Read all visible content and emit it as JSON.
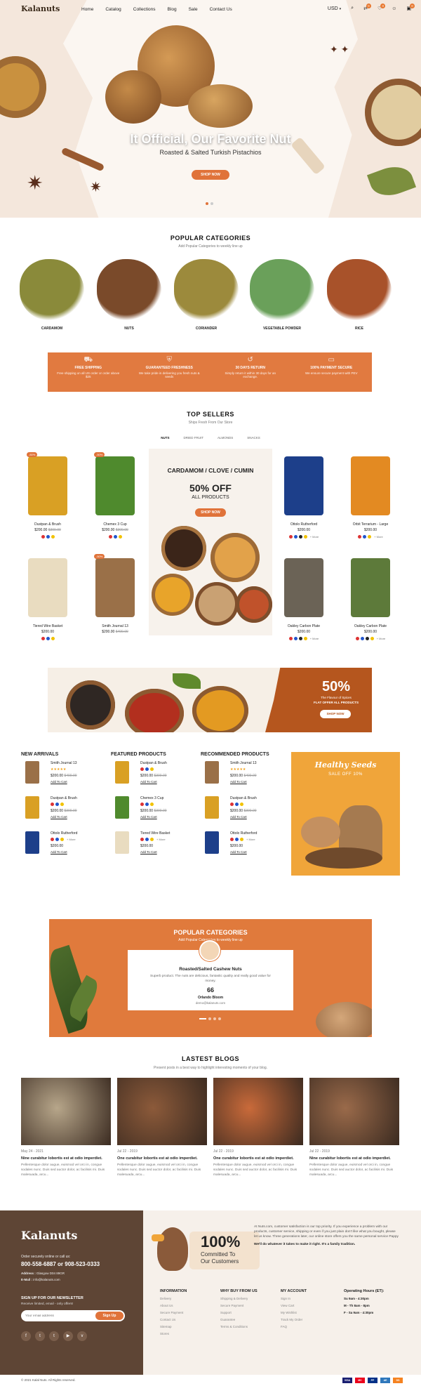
{
  "header": {
    "logo": "Kalanuts",
    "nav": [
      "Home",
      "Catalog",
      "Collections",
      "Blog",
      "Sale",
      "Contact Us"
    ],
    "currency": "USD",
    "compare_count": "0",
    "wishlist_count": "0",
    "cart_count": "0"
  },
  "hero": {
    "title": "It Official, Our Favorite Nut",
    "subtitle": "Roasted & Salted Turkish Pistachios",
    "button": "SHOP NOW"
  },
  "categories": {
    "title": "POPULAR CATEGORIES",
    "subtitle": "Add Popular Categories to weekly line up",
    "items": [
      {
        "label": "CARDAMOM",
        "color": "#8a8a3a"
      },
      {
        "label": "NUTS",
        "color": "#7a4a2a"
      },
      {
        "label": "CORIANDER",
        "color": "#9c8a3c"
      },
      {
        "label": "VEGETABLE POWDER",
        "color": "#6aa05a"
      },
      {
        "label": "RICE",
        "color": "#a8522a"
      }
    ]
  },
  "features": [
    {
      "icon": "truck-icon",
      "title": "FREE SHIPPING",
      "desc": "Free shipping on all US order or order above $25"
    },
    {
      "icon": "shield-icon",
      "title": "GUARANTEED FRESHNESS",
      "desc": "We take pride in delivering you fresh nuts & seeds"
    },
    {
      "icon": "return-icon",
      "title": "30 DAYS RETURN",
      "desc": "Simply return it within 30 days for an exchange."
    },
    {
      "icon": "card-icon",
      "title": "100% PAYMENT SECURE",
      "desc": "We ensure secure payment with PEV"
    }
  ],
  "top_sellers": {
    "title": "TOP SELLERS",
    "subtitle": "Ships Fresh From Our Store",
    "tabs": [
      "NUTS",
      "DRIED FRUIT",
      "ALMONDS",
      "SNACKS"
    ],
    "products": [
      {
        "name": "Dustpan & Brush",
        "price": "$200.00",
        "old": "$300.00",
        "sale": "-50%",
        "color": "#d9a024",
        "dots": [
          "#d33",
          "#2255cc",
          "#f2c200"
        ],
        "more": ""
      },
      {
        "name": "Chemex 3 Cup",
        "price": "$200.00",
        "old": "$300.00",
        "sale": "-50%",
        "color": "#4f8a2d",
        "dots": [
          "#d33",
          "#2255cc",
          "#f2c200"
        ],
        "more": ""
      },
      {
        "name": "Ottolo Rutherford",
        "price": "$200.00",
        "old": "",
        "sale": "",
        "color": "#1d3f8a",
        "dots": [
          "#d33",
          "#2255cc",
          "#222",
          "#f2c200"
        ],
        "more": "+ More"
      },
      {
        "name": "Orbit Terrarium - Large",
        "price": "$200.00",
        "old": "",
        "sale": "",
        "color": "#e38a22",
        "dots": [
          "#d33",
          "#2255cc",
          "#f2c200"
        ],
        "more": "+ More"
      },
      {
        "name": "Tiered Wire Basket",
        "price": "$200.00",
        "old": "",
        "sale": "",
        "color": "#e9dcc0",
        "dots": [
          "#d33",
          "#2255cc",
          "#f2c200"
        ],
        "more": ""
      },
      {
        "name": "Smith Journal 13",
        "price": "$200.00",
        "old": "$400.00",
        "sale": "-50%",
        "color": "#9a7048",
        "dots": [],
        "more": ""
      },
      {
        "name": "Oakley Carbon Plate",
        "price": "$200.00",
        "old": "",
        "sale": "",
        "color": "#6b6356",
        "dots": [
          "#d33",
          "#2255cc",
          "#222",
          "#f2c200"
        ],
        "more": "+ More"
      },
      {
        "name": "Oakley Carbon Plate",
        "price": "$200.00",
        "old": "",
        "sale": "",
        "color": "#5d7a3a",
        "dots": [
          "#d33",
          "#2255cc",
          "#222",
          "#f2c200"
        ],
        "more": "+ More"
      }
    ],
    "promo": {
      "heading": "CARDAMOM / CLOVE / CUMIN",
      "discount": "50% OFF",
      "sub": "ALL PRODUCTS",
      "button": "SHOP NOW"
    }
  },
  "banner": {
    "percent": "50%",
    "line1": "The Flavour of Spices",
    "line2": "FLAT OFFER ALL PRODUCTS",
    "button": "SHOP NOW"
  },
  "lists": [
    {
      "title": "NEW ARRIVALS",
      "items": [
        {
          "name": "Smith Journal 13",
          "price": "$200.00",
          "old": "$400.00",
          "mark": "stars",
          "color": "#9a7048"
        },
        {
          "name": "Dustpan & Brush",
          "price": "$200.00",
          "old": "$300.00",
          "mark": "dots",
          "color": "#d9a024"
        },
        {
          "name": "Ottolo Rutherford",
          "price": "$200.00",
          "old": "",
          "mark": "dots",
          "color": "#1d3f8a"
        }
      ]
    },
    {
      "title": "FEATURED PRODUCTS",
      "items": [
        {
          "name": "Dustpan & Brush",
          "price": "$200.00",
          "old": "$300.00",
          "mark": "dots",
          "color": "#d9a024"
        },
        {
          "name": "Chemex 3 Cup",
          "price": "$200.00",
          "old": "$300.00",
          "mark": "dots",
          "color": "#4f8a2d"
        },
        {
          "name": "Tiered Wire Basket",
          "price": "$200.00",
          "old": "",
          "mark": "dots",
          "color": "#e9dcc0"
        }
      ]
    },
    {
      "title": "RECOMMENDED PRODUCTS",
      "items": [
        {
          "name": "Smith Journal 13",
          "price": "$200.00",
          "old": "$400.00",
          "mark": "stars",
          "color": "#9a7048"
        },
        {
          "name": "Dustpan & Brush",
          "price": "$200.00",
          "old": "$300.00",
          "mark": "dots",
          "color": "#d9a024"
        },
        {
          "name": "Ottolo Rutherford",
          "price": "$200.00",
          "old": "",
          "mark": "dots",
          "color": "#1d3f8a"
        }
      ]
    }
  ],
  "list_labels": {
    "add_to_cart": "Add To Cart",
    "more": "+ More",
    "stars": "★★★★★"
  },
  "side_promo": {
    "title": "Healthy Seeds",
    "sub": "SALE OFF 10%"
  },
  "testimonial": {
    "title": "POPULAR CATEGORIES",
    "subtitle": "Add Popular Categories to weekly line up",
    "heading": "Roasted/Salted Cashew Nuts",
    "text": "Superb product. The nuts are delicious, fantastic quality and really good value for money.",
    "quote": "66",
    "author": "Orlando Bloom",
    "email": "demo@kalanuts.com"
  },
  "blogs": {
    "title": "LASTEST BLOGS",
    "subtitle": "Present posts in a best way to highlight interesting moments of your blog.",
    "posts": [
      {
        "date": "May 24 - 2021",
        "title": "Nine curabitur lobortis est at odio imperdiet.",
        "text": "Pellentesque dolor augue, euismod vel orci in, congue sodales nunc. Duis sed auctor dolor, ac facilisis mi. Duis malesuada, arcu...",
        "color": "#b7a68a"
      },
      {
        "date": "Jul 22 - 2019",
        "title": "One curabitur lobortis est at odio imperdiet.",
        "text": "Pellentesque dolor augue, euismod vel orci in, congue sodales nunc. Duis sed auctor dolor, ac facilisis mi. Duis malesuada, arcu...",
        "color": "#8c5a3a"
      },
      {
        "date": "Jul 22 - 2019",
        "title": "One curabitur lobortis est at odio imperdiet.",
        "text": "Pellentesque dolor augue, euismod vel orci in, congue sodales nunc. Duis sed auctor dolor, ac facilisis mi. Duis malesuada, arcu...",
        "color": "#c96a3a"
      },
      {
        "date": "Jul 22 - 2019",
        "title": "Nine curabitur lobortis est at odio imperdiet.",
        "text": "Pellentesque dolor augue, euismod vel orci in, congue sodales nunc. Duis sed auctor dolor, ac facilisis mi. Duis malesuada, arcu...",
        "color": "#9a6a4a"
      }
    ]
  },
  "footer": {
    "logo": "Kalanuts",
    "order_text": "Order securely online or call us:",
    "phone": "800-558-6887 or 908-523-0333",
    "address_label": "Address :",
    "address": "Glasgow D04 89GR",
    "email_label": "E-Mail :",
    "email": "info@kalanuts.com",
    "newsletter_title": "SIGN UP FOR OUR NEWSLETTER",
    "newsletter_sub": "Receive limited, email - only offers!",
    "email_placeholder": "Your email address",
    "signup": "Sign Up",
    "social": [
      "f",
      "t",
      "t",
      "▶",
      "v"
    ],
    "big_percent": "100%",
    "committed": "Committed To",
    "our_customers": "Our Customers",
    "about": "At Nuts.com, customer satisfaction is our top priority. If you experience a problem with our products, customer service, shipping or even if you just plain don't like what you bought, please let us know. Three generations later, our online store offers you the same personal service Pappy",
    "about_bold": "We'll do whatever it takes to make it right. It's a family tradition.",
    "cols": [
      {
        "title": "INFORMATION",
        "items": [
          "Delivery",
          "About Us",
          "Secure Payment",
          "Contact Us",
          "Sitemap",
          "Stores"
        ]
      },
      {
        "title": "WHY BUY FROM US",
        "items": [
          "Shipping & Delivery",
          "Secure Payment",
          "Support",
          "Guarantee",
          "Terms & Conditions"
        ]
      },
      {
        "title": "MY ACCOUNT",
        "items": [
          "Sign In",
          "View Cart",
          "My Wishlist",
          "Track My Order",
          "FAQ"
        ]
      }
    ],
    "hours_title": "Operating Hours (ET):",
    "hours": [
      "Su 9am - 4:30pm",
      "M - Th 8am - 8pm",
      "F - Sa 9am - 4:30pm"
    ],
    "copyright": "© 2021 Kalal Nuts. All Rights reserved.",
    "payments": [
      "VISA",
      "MC",
      "PP",
      "AE",
      "DS"
    ]
  }
}
